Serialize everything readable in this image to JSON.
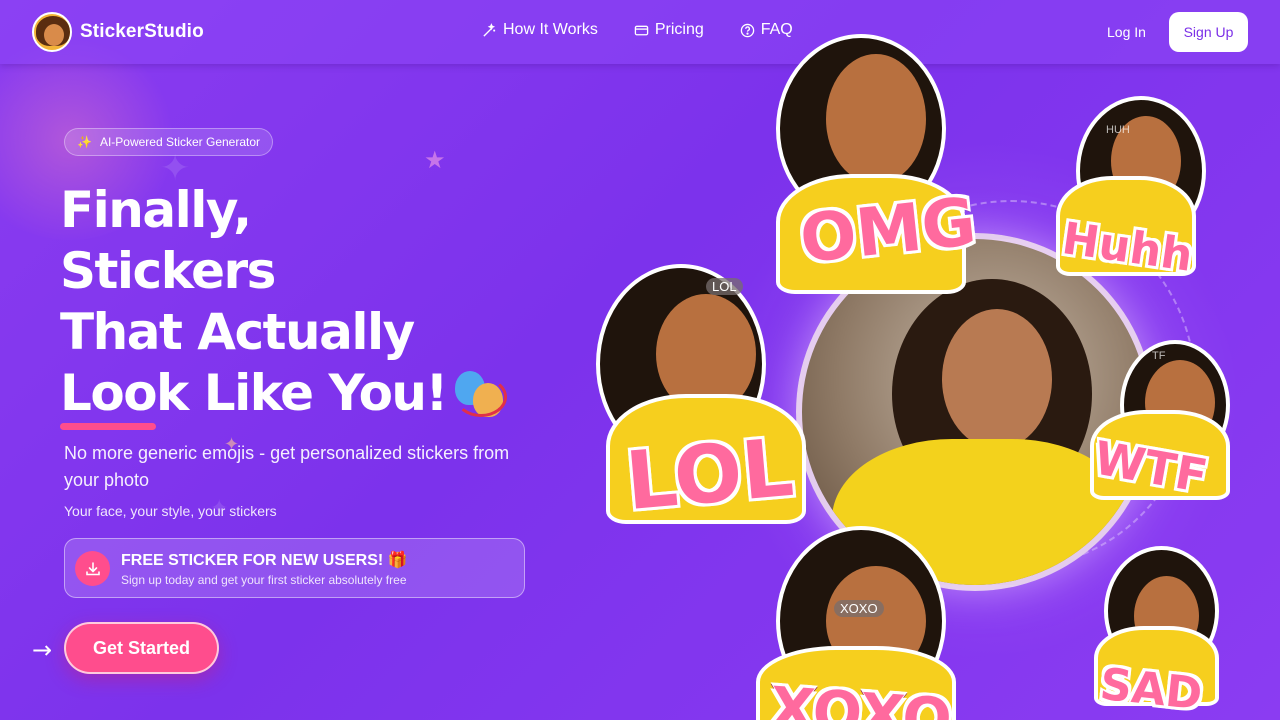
{
  "brand": {
    "name": "StickerStudio",
    "logo_icon": "avatar-logo-icon"
  },
  "nav": {
    "links": [
      {
        "label": "How It Works",
        "icon": "magic-wand-icon"
      },
      {
        "label": "Pricing",
        "icon": "credit-card-icon"
      },
      {
        "label": "FAQ",
        "icon": "question-circle-icon"
      }
    ],
    "login_label": "Log In",
    "signup_label": "Sign Up"
  },
  "hero": {
    "badge": {
      "icon": "✨",
      "label": "AI-Powered Sticker Generator"
    },
    "headline_lines": [
      "Finally,",
      "Stickers",
      "That Actually",
      "Look Like You!"
    ],
    "headline_emoji": "performing-arts-masks-icon",
    "subtitle": "No more generic emojis - get personalized stickers from your photo",
    "tagline": "Your face, your style, your stickers",
    "promo": {
      "title": "FREE STICKER FOR NEW USERS! 🎁",
      "subtitle": "Sign up today and get your first sticker absolutely free",
      "icon": "download-icon"
    },
    "cta_label": "Get Started",
    "arrow": "→"
  },
  "stickers": {
    "omg": "OMG",
    "huhh": "Huhh",
    "huh_tag": "HUH",
    "lol": "LOL",
    "lol_tag": "LOL",
    "wtf": "WTF",
    "wtf_tag": "TF",
    "xoxo": "XOXO",
    "xoxo_tag": "XOXO",
    "sad": "SAD"
  },
  "colors": {
    "background": "#8a3cf0",
    "accent_pink": "#ff4d8d",
    "signup_text": "#7b2fe8",
    "sticker_shirt": "#f6cf1e"
  }
}
